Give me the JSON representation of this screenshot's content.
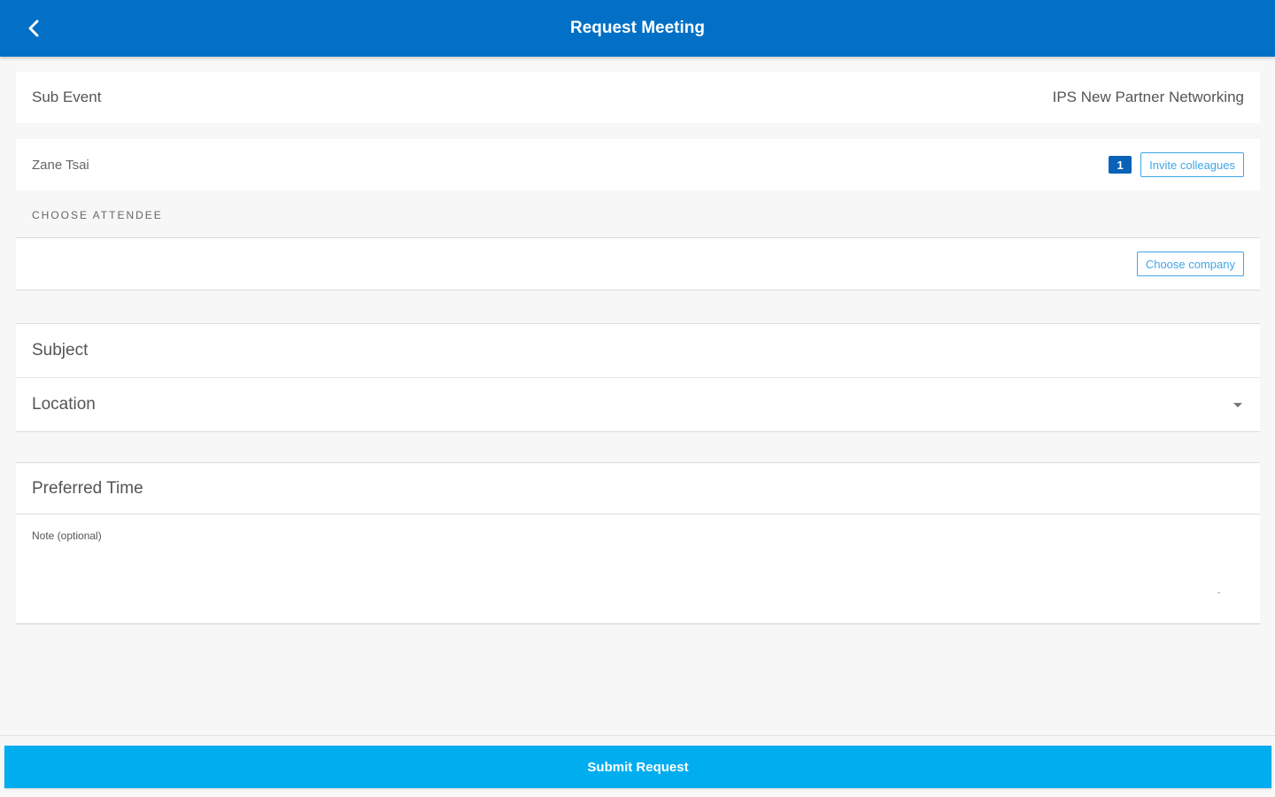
{
  "header": {
    "title": "Request Meeting",
    "back_icon": "chevron-left-icon"
  },
  "sub_event": {
    "label": "Sub Event",
    "value": "IPS New Partner Networking"
  },
  "attendee": {
    "name": "Zane Tsai",
    "count": "1",
    "invite_label": "Invite colleagues"
  },
  "choose_attendee": {
    "section_label": "CHOOSE ATTENDEE",
    "choose_company_label": "Choose company"
  },
  "form": {
    "subject_placeholder": "Subject",
    "location_placeholder": "Location",
    "location_icon": "chevron-down-icon",
    "preferred_time_placeholder": "Preferred Time",
    "note_label": "Note (optional)"
  },
  "footer": {
    "submit_label": "Submit Request"
  },
  "colors": {
    "app_bar": "#0270c6",
    "submit": "#00adef",
    "badge": "#0a62b8",
    "outline_accent": "#3fa6e6"
  }
}
